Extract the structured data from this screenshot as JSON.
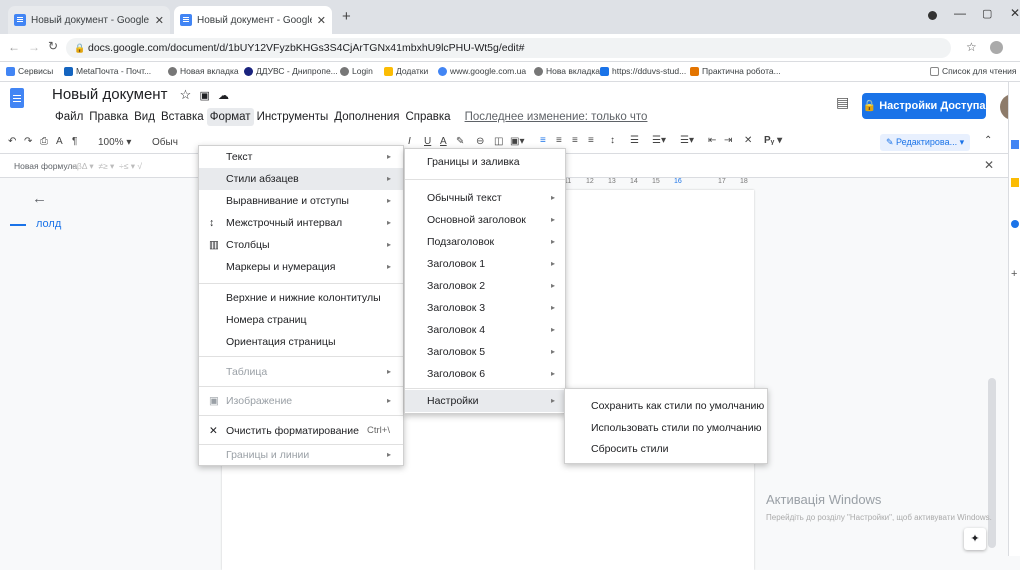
{
  "browser": {
    "tabs": [
      {
        "title": "Новый документ - Google Док"
      },
      {
        "title": "Новый документ - Google Док"
      }
    ],
    "new_tab": "+",
    "url": "docs.google.com/document/d/1bUY12VFyzbKHGs3S4CjArTGNx41mbxhU9lcPHU-Wt5g/edit#",
    "bookmarks": [
      "Сервисы",
      "MetaПочта - Почт...",
      "Новая вкладка",
      "ДДУВС - Днипропе...",
      "Login",
      "Додатки",
      "www.google.com.ua",
      "Нова вкладка",
      "https://dduvs-stud...",
      "Практична робота..."
    ],
    "reading_list": "Список для чтения"
  },
  "doc": {
    "title": "Новый документ",
    "menus": [
      "Файл",
      "Правка",
      "Вид",
      "Вставка",
      "Формат",
      "Инструменты",
      "Дополнения",
      "Справка"
    ],
    "last_edit": "Последнее изменение: только что",
    "share_label": "Настройки Доступа",
    "editing_mode": "Редактирова...",
    "zoom": "100%",
    "style_select": "Обыч",
    "formula_label": "Новая формула",
    "outline_text": "лолд"
  },
  "format_menu": {
    "items": [
      {
        "label": "Текст",
        "arrow": "▸",
        "disabled": false
      },
      {
        "label": "Стили абзацев",
        "arrow": "▸",
        "disabled": false
      },
      {
        "label": "Выравнивание и отступы",
        "arrow": "▸",
        "disabled": false
      },
      {
        "label": "Межстрочный интервал",
        "arrow": "▸",
        "disabled": false
      },
      {
        "label": "Столбцы",
        "arrow": "▸",
        "disabled": false
      },
      {
        "label": "Маркеры и нумерация",
        "arrow": "▸",
        "disabled": false
      },
      {
        "label": "Верхние и нижние колонтитулы",
        "disabled": false
      },
      {
        "label": "Номера страниц",
        "disabled": false
      },
      {
        "label": "Ориентация страницы",
        "disabled": false
      },
      {
        "label": "Таблица",
        "arrow": "▸",
        "disabled": true
      },
      {
        "label": "Изображение",
        "arrow": "▸",
        "disabled": true
      },
      {
        "label": "Очистить форматирование",
        "shortcut": "Ctrl+\\",
        "disabled": false
      },
      {
        "label": "Границы и линии",
        "arrow": "▸",
        "disabled": true
      }
    ]
  },
  "styles_menu": {
    "items": [
      {
        "label": "Границы и заливка"
      },
      {
        "label": "Обычный текст",
        "arrow": "▸"
      },
      {
        "label": "Основной заголовок",
        "arrow": "▸"
      },
      {
        "label": "Подзаголовок",
        "arrow": "▸"
      },
      {
        "label": "Заголовок 1",
        "arrow": "▸"
      },
      {
        "label": "Заголовок 2",
        "arrow": "▸"
      },
      {
        "label": "Заголовок 3",
        "arrow": "▸"
      },
      {
        "label": "Заголовок 4",
        "arrow": "▸"
      },
      {
        "label": "Заголовок 5",
        "arrow": "▸"
      },
      {
        "label": "Заголовок 6",
        "arrow": "▸"
      },
      {
        "label": "Настройки",
        "arrow": "▸"
      }
    ]
  },
  "settings_menu": {
    "items": [
      {
        "label": "Сохранить как стили по умолчанию"
      },
      {
        "label": "Использовать стили по умолчанию"
      },
      {
        "label": "Сбросить стили"
      }
    ]
  },
  "ruler_marks": [
    "11",
    "12",
    "13",
    "14",
    "15",
    "16",
    "17",
    "18"
  ],
  "watermark": {
    "title": "Активація Windows",
    "line": "Перейдіть до розділу \"Настройки\", щоб активувати Windows."
  },
  "colors": {
    "accent": "#1a73e8",
    "doc_icon": "#4285f4"
  }
}
